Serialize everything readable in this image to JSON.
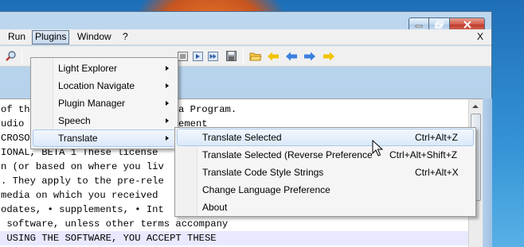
{
  "menubar": {
    "items": [
      "Run",
      "Plugins",
      "Window",
      "?"
    ],
    "active": "Plugins",
    "mdi_close": "X"
  },
  "toolbar": {
    "icons": [
      "find-icon",
      "macro-record-icon",
      "macro-playback-icon",
      "macro-playback-multiple-icon",
      "save-macro-icon",
      "open-folder-icon",
      "arrow-left-yellow-icon",
      "arrow-left-blue-icon",
      "arrow-right-blue-icon",
      "arrow-right-yellow-icon"
    ],
    "colors": {
      "yellow_arrow": "#f2c400",
      "blue_arrow": "#3b7fe0"
    }
  },
  "editor": {
    "lines": [
      "of th",
      "udio",
      "CROSO",
      "IONAL, BETA 1 These license",
      "n (or based on where you liv",
      ". They apply to the pre-rele",
      "media on which you received",
      "odates, • supplements, • Int",
      " software, unless other terms accompany",
      " USING THE SOFTWARE, YOU ACCEPT THESE"
    ],
    "partial_behind_submenu": [
      "a Program.",
      "ement"
    ]
  },
  "plugins_menu": {
    "items": [
      {
        "label": "Light Explorer",
        "has_submenu": true
      },
      {
        "label": "Location Navigate",
        "has_submenu": true
      },
      {
        "label": "Plugin Manager",
        "has_submenu": true
      },
      {
        "label": "Speech",
        "has_submenu": true
      },
      {
        "label": "Translate",
        "has_submenu": true,
        "selected": true
      }
    ]
  },
  "translate_menu": {
    "items": [
      {
        "label": "Translate Selected",
        "shortcut": "Ctrl+Alt+Z",
        "selected": true
      },
      {
        "label": "Translate Selected (Reverse Preference",
        "shortcut": "Ctrl+Alt+Shift+Z"
      },
      {
        "label": "Translate Code Style Strings",
        "shortcut": "Ctrl+Alt+X"
      },
      {
        "label": "Change Language Preference",
        "shortcut": ""
      },
      {
        "label": "About",
        "shortcut": ""
      }
    ]
  },
  "colors": {
    "menu_highlight": "#dbe9f9",
    "menu_highlight_border": "#a8c8ec",
    "editor_line_highlight": "#e8e8ff",
    "desktop_blue": "#2a86cc",
    "close_button": "#c03a2c"
  }
}
